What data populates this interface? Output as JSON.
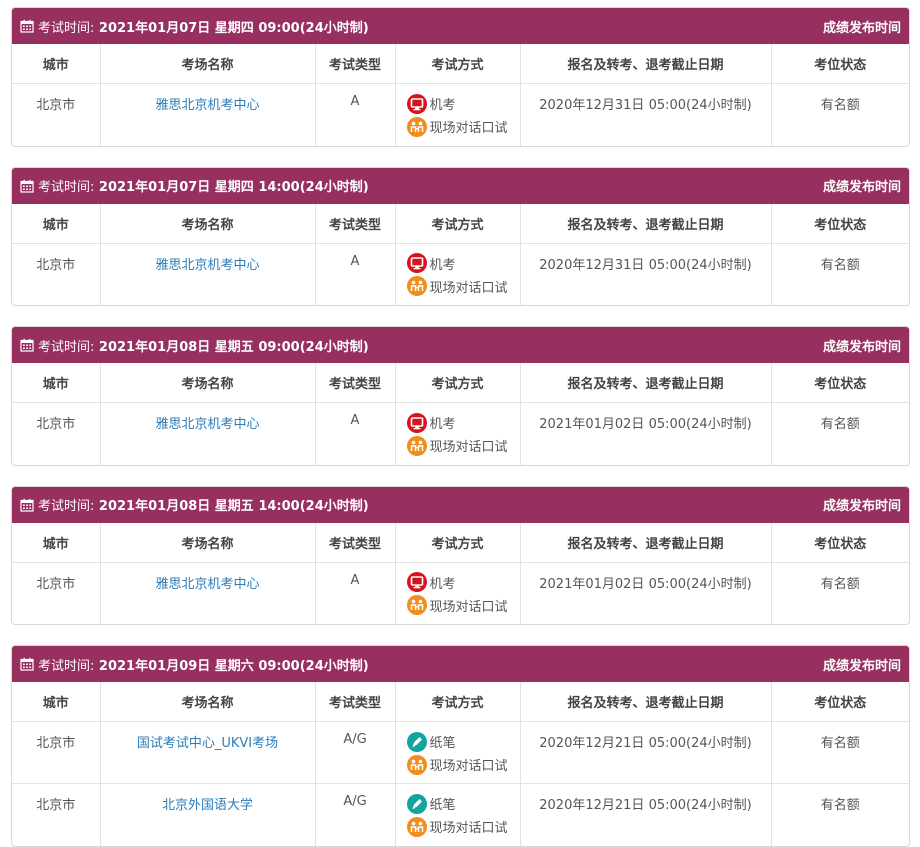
{
  "header_label": "考试时间:",
  "header_right": "成绩发布时间",
  "columns": [
    "城市",
    "考场名称",
    "考试类型",
    "考试方式",
    "报名及转考、退考截止日期",
    "考位状态"
  ],
  "colors": {
    "header_bg": "#97305f",
    "link": "#2b7cb8",
    "computer_icon": "#d7121c",
    "speaking_icon": "#ef8e1c",
    "paper_icon": "#10a5a0"
  },
  "sessions": [
    {
      "datetime": "2021年01月07日 星期四 09:00(24小时制)",
      "rows": [
        {
          "city": "北京市",
          "venue": "雅思北京机考中心",
          "type": "A",
          "methods": [
            {
              "icon": "monitor-icon",
              "label": "机考"
            },
            {
              "icon": "speaking-icon",
              "label": "现场对话口试"
            }
          ],
          "deadline": "2020年12月31日 05:00(24小时制)",
          "status": "有名额"
        }
      ]
    },
    {
      "datetime": "2021年01月07日 星期四 14:00(24小时制)",
      "rows": [
        {
          "city": "北京市",
          "venue": "雅思北京机考中心",
          "type": "A",
          "methods": [
            {
              "icon": "monitor-icon",
              "label": "机考"
            },
            {
              "icon": "speaking-icon",
              "label": "现场对话口试"
            }
          ],
          "deadline": "2020年12月31日 05:00(24小时制)",
          "status": "有名额"
        }
      ]
    },
    {
      "datetime": "2021年01月08日 星期五 09:00(24小时制)",
      "rows": [
        {
          "city": "北京市",
          "venue": "雅思北京机考中心",
          "type": "A",
          "methods": [
            {
              "icon": "monitor-icon",
              "label": "机考"
            },
            {
              "icon": "speaking-icon",
              "label": "现场对话口试"
            }
          ],
          "deadline": "2021年01月02日 05:00(24小时制)",
          "status": "有名额"
        }
      ]
    },
    {
      "datetime": "2021年01月08日 星期五 14:00(24小时制)",
      "rows": [
        {
          "city": "北京市",
          "venue": "雅思北京机考中心",
          "type": "A",
          "methods": [
            {
              "icon": "monitor-icon",
              "label": "机考"
            },
            {
              "icon": "speaking-icon",
              "label": "现场对话口试"
            }
          ],
          "deadline": "2021年01月02日 05:00(24小时制)",
          "status": "有名额"
        }
      ]
    },
    {
      "datetime": "2021年01月09日 星期六 09:00(24小时制)",
      "rows": [
        {
          "city": "北京市",
          "venue": "国试考试中心_UKVI考场",
          "type": "A/G",
          "methods": [
            {
              "icon": "pencil-icon",
              "label": "纸笔"
            },
            {
              "icon": "speaking-icon",
              "label": "现场对话口试"
            }
          ],
          "deadline": "2020年12月21日 05:00(24小时制)",
          "status": "有名额"
        },
        {
          "city": "北京市",
          "venue": "北京外国语大学",
          "type": "A/G",
          "methods": [
            {
              "icon": "pencil-icon",
              "label": "纸笔"
            },
            {
              "icon": "speaking-icon",
              "label": "现场对话口试"
            }
          ],
          "deadline": "2020年12月21日 05:00(24小时制)",
          "status": "有名额"
        }
      ]
    }
  ]
}
